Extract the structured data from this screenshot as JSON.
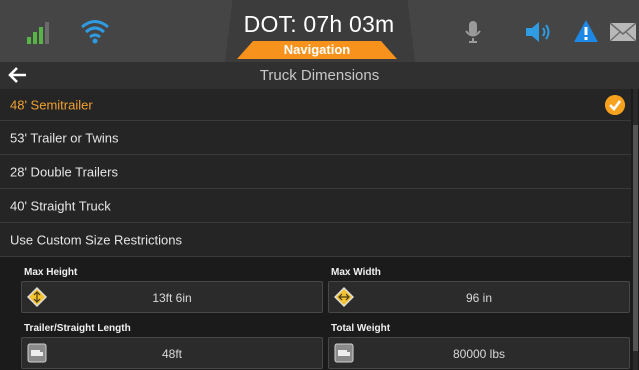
{
  "status": {
    "dot_label": "DOT: 07h 03m",
    "mode_badge": "Navigation",
    "icons": [
      "signal-icon",
      "wifi-icon",
      "microphone-icon",
      "speaker-icon",
      "alert-icon",
      "mail-icon"
    ],
    "colors": {
      "accent": "#f7931d",
      "signal": "#58b447",
      "wifi": "#2f9be3",
      "alert": "#1e88e5"
    }
  },
  "header": {
    "title": "Truck Dimensions"
  },
  "options": [
    {
      "label": "48' Semitrailer",
      "selected": true
    },
    {
      "label": "53' Trailer or Twins",
      "selected": false
    },
    {
      "label": "28' Double Trailers",
      "selected": false
    },
    {
      "label": "40' Straight Truck",
      "selected": false
    },
    {
      "label": "Use Custom Size Restrictions",
      "selected": false
    }
  ],
  "fields": {
    "max_height": {
      "label": "Max Height",
      "value": "13ft 6in"
    },
    "max_width": {
      "label": "Max Width",
      "value": "96 in"
    },
    "length": {
      "label": "Trailer/Straight Length",
      "value": "48ft"
    },
    "total_weight": {
      "label": "Total Weight",
      "value": "80000 lbs"
    }
  }
}
